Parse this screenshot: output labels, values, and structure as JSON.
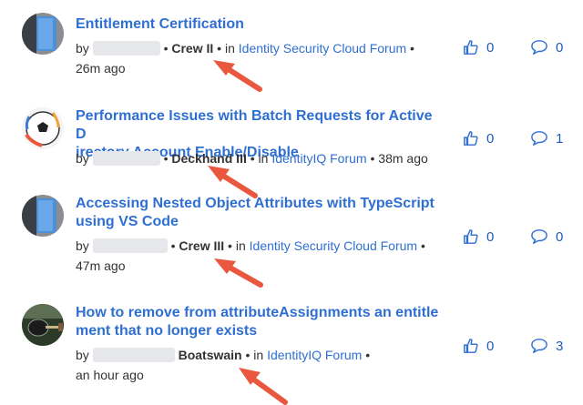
{
  "posts": [
    {
      "title_lines": [
        "Entitlement Certification"
      ],
      "by": "by",
      "rank": "Crew II",
      "in": "in",
      "forum": "Identity Security Cloud Forum",
      "time": "26m ago",
      "likes": "0",
      "replies": "0",
      "avatar": "blue-gray-avatar"
    },
    {
      "title_lines": [
        "Performance Issues with Batch Requests for Active D",
        "irectory Account Enable/Disable"
      ],
      "by": "by",
      "rank": "Deckhand III",
      "in": "in",
      "forum": "IdentityIQ Forum",
      "time": "38m ago",
      "likes": "0",
      "replies": "1",
      "avatar": "soccer-ball-avatar"
    },
    {
      "title_lines": [
        "Accessing Nested Object Attributes with TypeScript",
        "using VS Code"
      ],
      "by": "by",
      "rank": "Crew III",
      "in": "in",
      "forum": "Identity Security Cloud Forum",
      "time": "47m ago",
      "likes": "0",
      "replies": "0",
      "avatar": "blue-gray-avatar"
    },
    {
      "title_lines": [
        "How to remove from attributeAssignments an entitle",
        "ment that no longer exists"
      ],
      "by": "by",
      "rank": "Boatswain",
      "in": "in",
      "forum": "IdentityIQ Forum",
      "time": "an hour ago",
      "likes": "0",
      "replies": "3",
      "avatar": "guitar-avatar"
    }
  ],
  "colors": {
    "link": "#2f6fd1",
    "arrow": "#e9573f"
  },
  "icons": {
    "like": "thumbs-up-icon",
    "reply": "speech-bubble-icon"
  }
}
